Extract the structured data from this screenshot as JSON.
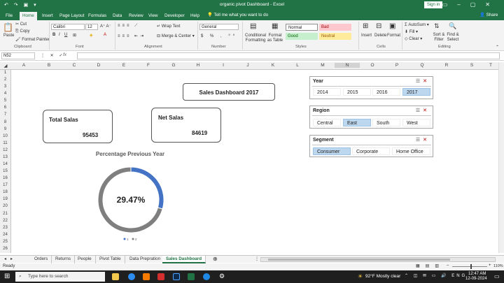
{
  "window": {
    "title": "organic pivot  Dashboard  -  Excel",
    "sign_in": "Sign in",
    "share": "Share",
    "tell_me": "Tell me what you want to do"
  },
  "ribbon_tabs": [
    "File",
    "Home",
    "Insert",
    "Page Layout",
    "Formulas",
    "Data",
    "Review",
    "View",
    "Developer",
    "Help"
  ],
  "ribbon": {
    "paste": "Paste",
    "cut": "Cut",
    "copy": "Copy",
    "format_painter": "Format Painter",
    "clipboard": "Clipboard",
    "font_name": "Calibri",
    "font_size": "12",
    "font": "Font",
    "wrap_text": "Wrap Text",
    "merge_center": "Merge & Center",
    "alignment": "Alignment",
    "number_format": "General",
    "number": "Number",
    "conditional_formatting": "Conditional Formatting",
    "format_as_table": "Format as Table",
    "style_normal": "Normal",
    "style_bad": "Bad",
    "style_good": "Good",
    "style_neutral": "Neutral",
    "styles": "Styles",
    "insert": "Insert",
    "delete": "Delete",
    "format": "Format",
    "cells": "Cells",
    "autosum": "AutoSum",
    "fill": "Fill",
    "clear": "Clear",
    "sort_filter": "Sort & Filter",
    "find_select": "Find & Select",
    "editing": "Editing"
  },
  "formula_bar": {
    "name_box": "N52",
    "fx": "fx",
    "content": ""
  },
  "columns": [
    "A",
    "B",
    "C",
    "D",
    "E",
    "F",
    "G",
    "H",
    "I",
    "J",
    "K",
    "L",
    "M",
    "N",
    "O",
    "P",
    "Q",
    "R",
    "S",
    "T"
  ],
  "rows": [
    "1",
    "2",
    "3",
    "4",
    "5",
    "6",
    "7",
    "8",
    "9",
    "10",
    "11",
    "12",
    "13",
    "14",
    "15",
    "16",
    "17",
    "18",
    "19",
    "20",
    "21",
    "22",
    "23",
    "24",
    "25",
    "26"
  ],
  "dashboard": {
    "title": "Sales Dashboard 2017",
    "total_sales_label": "Total Salas",
    "total_sales_value": "95453",
    "net_sales_label": "Net Salas",
    "net_sales_value": "84619"
  },
  "chart_data": {
    "type": "pie",
    "title": "Percentage Previous Year",
    "center_label": "29.47%",
    "categories": [
      "1",
      "2"
    ],
    "values": [
      29.47,
      70.53
    ],
    "colors": [
      "#4472c4",
      "#7f7f7f"
    ]
  },
  "slicers": {
    "year": {
      "title": "Year",
      "items": [
        "2014",
        "2015",
        "2016",
        "2017"
      ],
      "selected": "2017"
    },
    "region": {
      "title": "Region",
      "items": [
        "Central",
        "East",
        "South",
        "West"
      ],
      "selected": "East"
    },
    "segment": {
      "title": "Segment",
      "items": [
        "Consumer",
        "Corporate",
        "Home Office"
      ],
      "selected": "Consumer"
    }
  },
  "sheet_tabs": [
    "Orders",
    "Returns",
    "People",
    "Pivot Table",
    "Data Prepration",
    "Sales Dashboard"
  ],
  "active_sheet": "Sales Dashboard",
  "status": {
    "ready": "Ready",
    "zoom": "110%"
  },
  "taskbar": {
    "search_placeholder": "Type here to search",
    "weather": "92°F  Mostly clear",
    "time": "12:47 AM",
    "date": "12-09-2024"
  },
  "colors": {
    "excel_green": "#217346",
    "slicer_selected": "#bdd7ee",
    "accent": "#4472c4"
  }
}
